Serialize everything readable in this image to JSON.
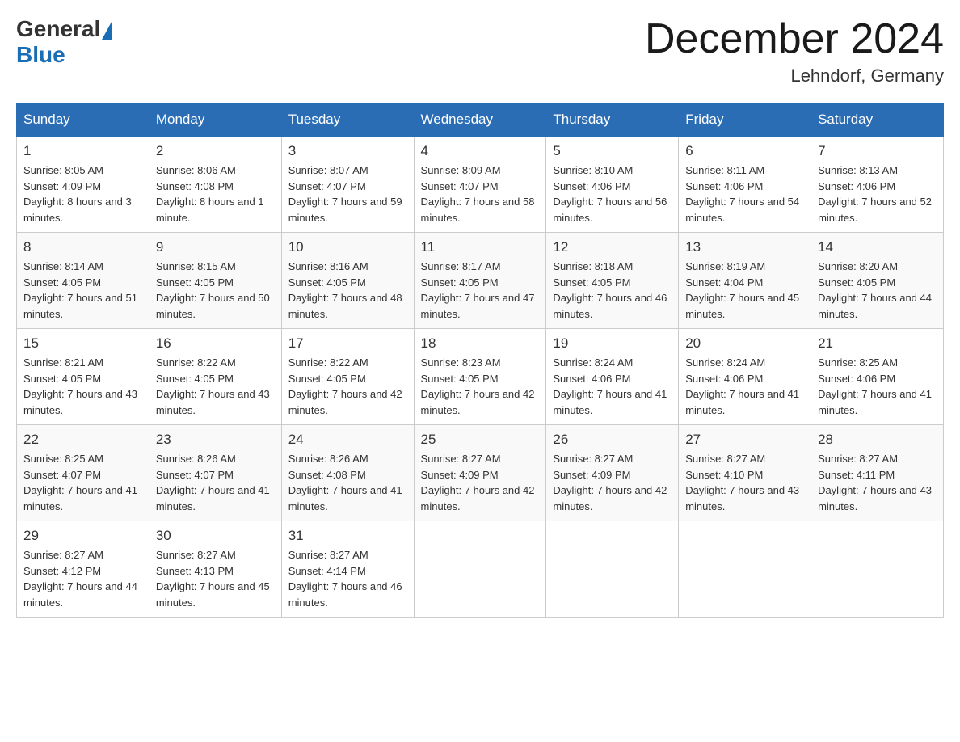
{
  "header": {
    "logo_general": "General",
    "logo_blue": "Blue",
    "month_title": "December 2024",
    "location": "Lehndorf, Germany"
  },
  "calendar": {
    "days_of_week": [
      "Sunday",
      "Monday",
      "Tuesday",
      "Wednesday",
      "Thursday",
      "Friday",
      "Saturday"
    ],
    "weeks": [
      [
        {
          "day": "1",
          "sunrise": "8:05 AM",
          "sunset": "4:09 PM",
          "daylight": "8 hours and 3 minutes."
        },
        {
          "day": "2",
          "sunrise": "8:06 AM",
          "sunset": "4:08 PM",
          "daylight": "8 hours and 1 minute."
        },
        {
          "day": "3",
          "sunrise": "8:07 AM",
          "sunset": "4:07 PM",
          "daylight": "7 hours and 59 minutes."
        },
        {
          "day": "4",
          "sunrise": "8:09 AM",
          "sunset": "4:07 PM",
          "daylight": "7 hours and 58 minutes."
        },
        {
          "day": "5",
          "sunrise": "8:10 AM",
          "sunset": "4:06 PM",
          "daylight": "7 hours and 56 minutes."
        },
        {
          "day": "6",
          "sunrise": "8:11 AM",
          "sunset": "4:06 PM",
          "daylight": "7 hours and 54 minutes."
        },
        {
          "day": "7",
          "sunrise": "8:13 AM",
          "sunset": "4:06 PM",
          "daylight": "7 hours and 52 minutes."
        }
      ],
      [
        {
          "day": "8",
          "sunrise": "8:14 AM",
          "sunset": "4:05 PM",
          "daylight": "7 hours and 51 minutes."
        },
        {
          "day": "9",
          "sunrise": "8:15 AM",
          "sunset": "4:05 PM",
          "daylight": "7 hours and 50 minutes."
        },
        {
          "day": "10",
          "sunrise": "8:16 AM",
          "sunset": "4:05 PM",
          "daylight": "7 hours and 48 minutes."
        },
        {
          "day": "11",
          "sunrise": "8:17 AM",
          "sunset": "4:05 PM",
          "daylight": "7 hours and 47 minutes."
        },
        {
          "day": "12",
          "sunrise": "8:18 AM",
          "sunset": "4:05 PM",
          "daylight": "7 hours and 46 minutes."
        },
        {
          "day": "13",
          "sunrise": "8:19 AM",
          "sunset": "4:04 PM",
          "daylight": "7 hours and 45 minutes."
        },
        {
          "day": "14",
          "sunrise": "8:20 AM",
          "sunset": "4:05 PM",
          "daylight": "7 hours and 44 minutes."
        }
      ],
      [
        {
          "day": "15",
          "sunrise": "8:21 AM",
          "sunset": "4:05 PM",
          "daylight": "7 hours and 43 minutes."
        },
        {
          "day": "16",
          "sunrise": "8:22 AM",
          "sunset": "4:05 PM",
          "daylight": "7 hours and 43 minutes."
        },
        {
          "day": "17",
          "sunrise": "8:22 AM",
          "sunset": "4:05 PM",
          "daylight": "7 hours and 42 minutes."
        },
        {
          "day": "18",
          "sunrise": "8:23 AM",
          "sunset": "4:05 PM",
          "daylight": "7 hours and 42 minutes."
        },
        {
          "day": "19",
          "sunrise": "8:24 AM",
          "sunset": "4:06 PM",
          "daylight": "7 hours and 41 minutes."
        },
        {
          "day": "20",
          "sunrise": "8:24 AM",
          "sunset": "4:06 PM",
          "daylight": "7 hours and 41 minutes."
        },
        {
          "day": "21",
          "sunrise": "8:25 AM",
          "sunset": "4:06 PM",
          "daylight": "7 hours and 41 minutes."
        }
      ],
      [
        {
          "day": "22",
          "sunrise": "8:25 AM",
          "sunset": "4:07 PM",
          "daylight": "7 hours and 41 minutes."
        },
        {
          "day": "23",
          "sunrise": "8:26 AM",
          "sunset": "4:07 PM",
          "daylight": "7 hours and 41 minutes."
        },
        {
          "day": "24",
          "sunrise": "8:26 AM",
          "sunset": "4:08 PM",
          "daylight": "7 hours and 41 minutes."
        },
        {
          "day": "25",
          "sunrise": "8:27 AM",
          "sunset": "4:09 PM",
          "daylight": "7 hours and 42 minutes."
        },
        {
          "day": "26",
          "sunrise": "8:27 AM",
          "sunset": "4:09 PM",
          "daylight": "7 hours and 42 minutes."
        },
        {
          "day": "27",
          "sunrise": "8:27 AM",
          "sunset": "4:10 PM",
          "daylight": "7 hours and 43 minutes."
        },
        {
          "day": "28",
          "sunrise": "8:27 AM",
          "sunset": "4:11 PM",
          "daylight": "7 hours and 43 minutes."
        }
      ],
      [
        {
          "day": "29",
          "sunrise": "8:27 AM",
          "sunset": "4:12 PM",
          "daylight": "7 hours and 44 minutes."
        },
        {
          "day": "30",
          "sunrise": "8:27 AM",
          "sunset": "4:13 PM",
          "daylight": "7 hours and 45 minutes."
        },
        {
          "day": "31",
          "sunrise": "8:27 AM",
          "sunset": "4:14 PM",
          "daylight": "7 hours and 46 minutes."
        },
        null,
        null,
        null,
        null
      ]
    ]
  }
}
